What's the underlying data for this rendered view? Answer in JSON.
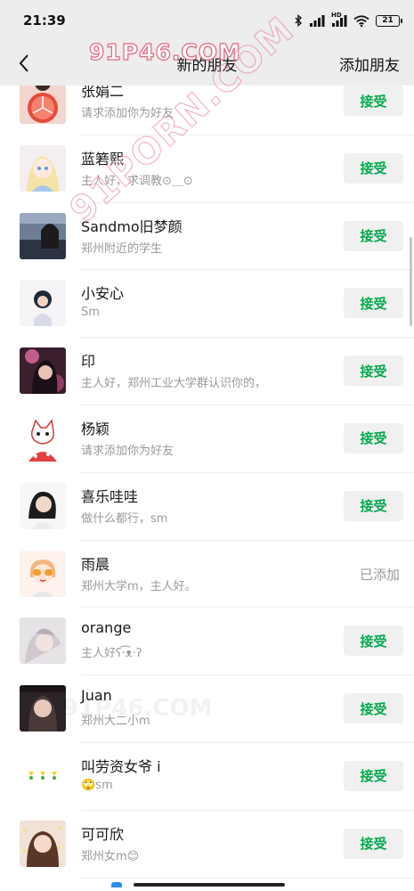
{
  "status_bar": {
    "time": "21:39",
    "network_label": "HD",
    "battery": "21",
    "icons": [
      "bluetooth-icon",
      "signal-icon",
      "hd-signal-icon",
      "wifi-icon",
      "battery-icon"
    ]
  },
  "nav": {
    "title": "新的朋友",
    "action_label": "添加朋友",
    "back_icon": "chevron-left-icon"
  },
  "watermarks": {
    "top": "91P46.COM",
    "diagonal": "91PORN.COM",
    "faint": "91P46.COM"
  },
  "accept_label": "接受",
  "added_label": "已添加",
  "friends": [
    {
      "name": "张娟二",
      "note": "请求添加你为好友",
      "status": "accept"
    },
    {
      "name": "蓝箬熙",
      "note": "主人好，求调教⊙＿⊙",
      "status": "accept"
    },
    {
      "name": "Sandmo旧梦颜",
      "note": "郑州附近的学生",
      "status": "accept"
    },
    {
      "name": "小安心",
      "note": "Sm",
      "status": "accept"
    },
    {
      "name": "印",
      "note": "主人好，郑州工业大学群认识你的，",
      "status": "accept"
    },
    {
      "name": "杨颖",
      "note": "请求添加你为好友",
      "status": "accept"
    },
    {
      "name": "喜乐哇哇",
      "note": "做什么都行，sm",
      "status": "accept"
    },
    {
      "name": "雨晨",
      "note": "郑州大学m，主人好。",
      "status": "added"
    },
    {
      "name": "orange",
      "note": "主人好ʕ·͡ᴥ·ʔ",
      "status": "accept"
    },
    {
      "name": "Juan",
      "note": "郑州大二小m",
      "status": "accept"
    },
    {
      "name": "叫劳资女爷 i",
      "note": "🙄sm",
      "status": "accept"
    },
    {
      "name": "可可欣",
      "note": "郑州女m😊",
      "status": "accept"
    }
  ],
  "colors": {
    "accent_green": "#07a84f",
    "watermark_pink": "#e0607a",
    "background": "#ededed"
  }
}
